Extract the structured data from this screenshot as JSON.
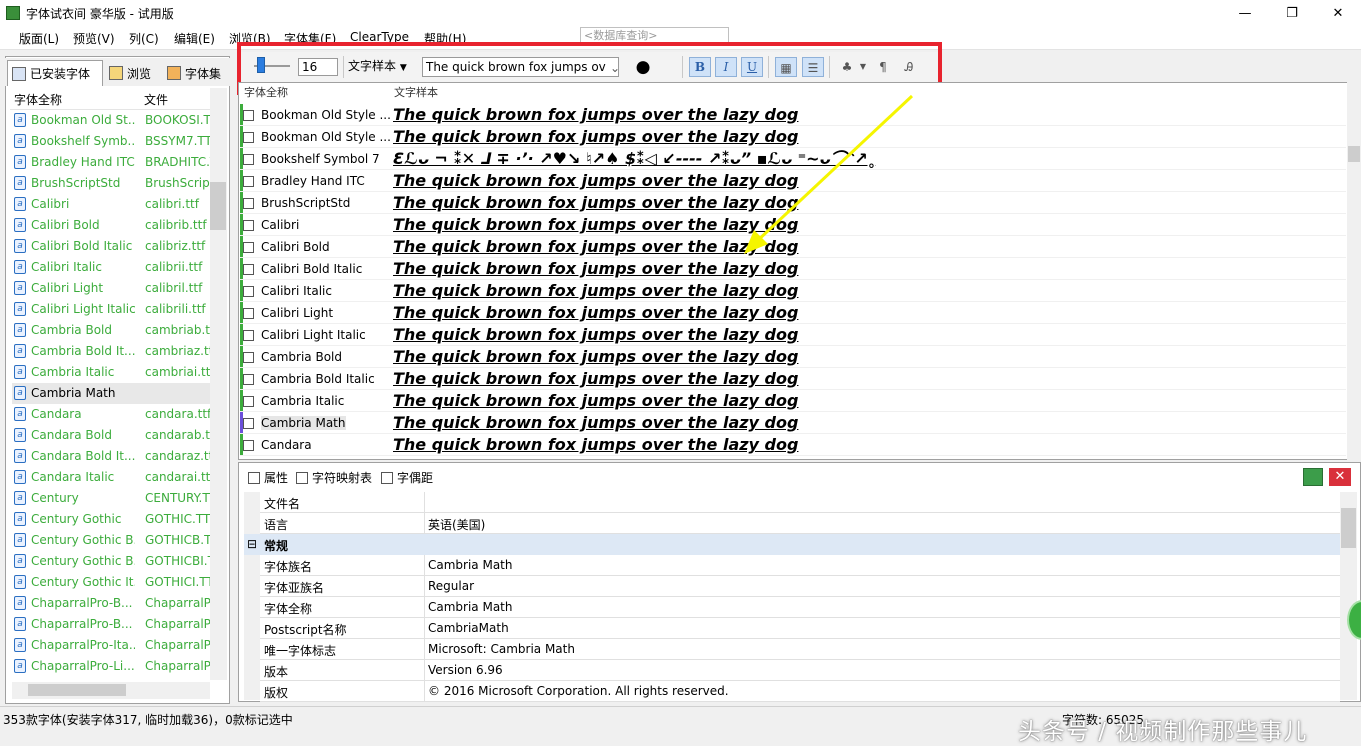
{
  "window": {
    "title": "字体试衣间 豪华版 - 试用版",
    "minimize": "—",
    "maximize": "❐",
    "close": "✕"
  },
  "menu": [
    "版面(L)",
    "预览(V)",
    "列(C)",
    "编辑(E)",
    "浏览(B)",
    "字体集(F)",
    "ClearType",
    "帮助(H)"
  ],
  "db_search_placeholder": "<数据库查询>",
  "left_tabs": [
    "已安装字体",
    "浏览",
    "字体集"
  ],
  "left_list": {
    "headers": [
      "字体全称",
      "文件"
    ],
    "selected": "Cambria Math",
    "rows": [
      {
        "name": "Bookman Old St...",
        "file": "BOOKOSI.TTF"
      },
      {
        "name": "Bookshelf Symb...",
        "file": "BSSYM7.TTF"
      },
      {
        "name": "Bradley Hand ITC",
        "file": "BRADHITC.TTF"
      },
      {
        "name": "BrushScriptStd",
        "file": "BrushScriptStd"
      },
      {
        "name": "Calibri",
        "file": "calibri.ttf"
      },
      {
        "name": "Calibri Bold",
        "file": "calibrib.ttf"
      },
      {
        "name": "Calibri Bold Italic",
        "file": "calibriz.ttf"
      },
      {
        "name": "Calibri Italic",
        "file": "calibrii.ttf"
      },
      {
        "name": "Calibri Light",
        "file": "calibril.ttf"
      },
      {
        "name": "Calibri Light Italic",
        "file": "calibrili.ttf"
      },
      {
        "name": "Cambria Bold",
        "file": "cambriab.ttf"
      },
      {
        "name": "Cambria Bold It...",
        "file": "cambriaz.ttf"
      },
      {
        "name": "Cambria Italic",
        "file": "cambriai.ttf"
      },
      {
        "name": "Cambria Math",
        "file": ""
      },
      {
        "name": "Candara",
        "file": "candara.ttf"
      },
      {
        "name": "Candara Bold",
        "file": "candarab.ttf"
      },
      {
        "name": "Candara Bold It...",
        "file": "candaraz.ttf"
      },
      {
        "name": "Candara Italic",
        "file": "candarai.ttf"
      },
      {
        "name": "Century",
        "file": "CENTURY.TTF"
      },
      {
        "name": "Century Gothic",
        "file": "GOTHIC.TTF"
      },
      {
        "name": "Century Gothic B...",
        "file": "GOTHICB.TTF"
      },
      {
        "name": "Century Gothic B...",
        "file": "GOTHICBI.TTF"
      },
      {
        "name": "Century Gothic It...",
        "file": "GOTHICI.TTF"
      },
      {
        "name": "ChaparralPro-B...",
        "file": "ChaparralPro"
      },
      {
        "name": "ChaparralPro-B...",
        "file": "ChaparralPro"
      },
      {
        "name": "ChaparralPro-Ita...",
        "file": "ChaparralPro"
      },
      {
        "name": "ChaparralPro-Li...",
        "file": "ChaparralPro"
      }
    ]
  },
  "toolbar": {
    "size": "16",
    "mode": "文字样本",
    "sample_text": "The quick brown fox jumps ov",
    "bold": "B",
    "italic": "I",
    "underline": "U"
  },
  "grid": {
    "headers": [
      "字体全称",
      "文字样本"
    ],
    "sample": "The quick brown fox jumps over the lazy dog",
    "symbol_sample": "Ꜫℒᴗ ¬ ⁑✕ ⅃ ∓ ·’· ↗♥↘ ♮↗♠ $⁑◁ ↙---- ↗⁑ᴗ” ▪ℒᴗ ⁼~ᴗ⌒ᵔ↗˳",
    "math_sample": "The quick brown fox jumps over the lazy dog",
    "rows": [
      {
        "name": "Bookman Old Style ...",
        "style": "bookman"
      },
      {
        "name": "Bookman Old Style ...",
        "style": "bookman"
      },
      {
        "name": "Bookshelf Symbol 7",
        "style": "symbol"
      },
      {
        "name": "Bradley Hand ITC",
        "style": "script"
      },
      {
        "name": "BrushScriptStd",
        "style": "brush"
      },
      {
        "name": "Calibri",
        "style": "sans"
      },
      {
        "name": "Calibri Bold",
        "style": "sans"
      },
      {
        "name": "Calibri Bold Italic",
        "style": "sans"
      },
      {
        "name": "Calibri Italic",
        "style": "sans"
      },
      {
        "name": "Calibri Light",
        "style": "light"
      },
      {
        "name": "Calibri Light Italic",
        "style": "light"
      },
      {
        "name": "Cambria Bold",
        "style": "serif"
      },
      {
        "name": "Cambria Bold Italic",
        "style": "serif"
      },
      {
        "name": "Cambria Italic",
        "style": "serif"
      },
      {
        "name": "Cambria Math",
        "style": "math"
      },
      {
        "name": "Candara",
        "style": "sans"
      }
    ]
  },
  "bottom_tabs": [
    "属性",
    "字符映射表",
    "字偶距"
  ],
  "properties": [
    {
      "k": "文件名",
      "v": ""
    },
    {
      "k": "语言",
      "v": "英语(美国)"
    },
    {
      "section": "常规"
    },
    {
      "k": "字体族名",
      "v": "Cambria Math"
    },
    {
      "k": "字体亚族名",
      "v": "Regular"
    },
    {
      "k": "字体全称",
      "v": "Cambria Math"
    },
    {
      "k": "Postscript名称",
      "v": "CambriaMath"
    },
    {
      "k": "唯一字体标志",
      "v": "Microsoft: Cambria Math"
    },
    {
      "k": "版本",
      "v": "Version 6.96"
    },
    {
      "k": "版权",
      "v": "© 2016 Microsoft Corporation. All rights reserved."
    }
  ],
  "status": {
    "left": "353款字体(安装字体317, 临时加载36)，0款标记选中",
    "right": "字符数: 65025"
  },
  "watermark": "头条号 / 视频制作那些事儿",
  "colors": {
    "highlight": "#e8232e",
    "arrow": "#f5f500",
    "list_text": "#3cac3c"
  }
}
